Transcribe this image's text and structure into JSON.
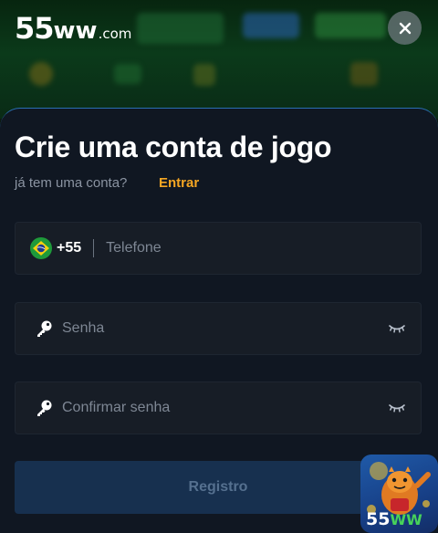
{
  "header": {
    "logo_number": "55",
    "logo_ww": "ww",
    "logo_domain": ".com",
    "close_icon": "close-icon"
  },
  "form": {
    "title": "Crie uma conta de jogo",
    "subtitle": "já tem uma conta?",
    "login_link": "Entrar",
    "phone": {
      "country_code": "+55",
      "flag": "brazil-flag-icon",
      "placeholder": "Telefone"
    },
    "password": {
      "placeholder": "Senha",
      "icon": "key-icon",
      "toggle_icon": "eye-closed-icon"
    },
    "confirm_password": {
      "placeholder": "Confirmar senha",
      "icon": "key-icon",
      "toggle_icon": "eye-closed-icon"
    },
    "submit_label": "Registro"
  },
  "app_badge": {
    "number": "55",
    "ww": "WW"
  },
  "colors": {
    "accent_link": "#f5a623",
    "sheet_bg": "#101722",
    "field_bg": "#171d26",
    "button_bg": "#17304f",
    "button_text": "#55708f"
  }
}
